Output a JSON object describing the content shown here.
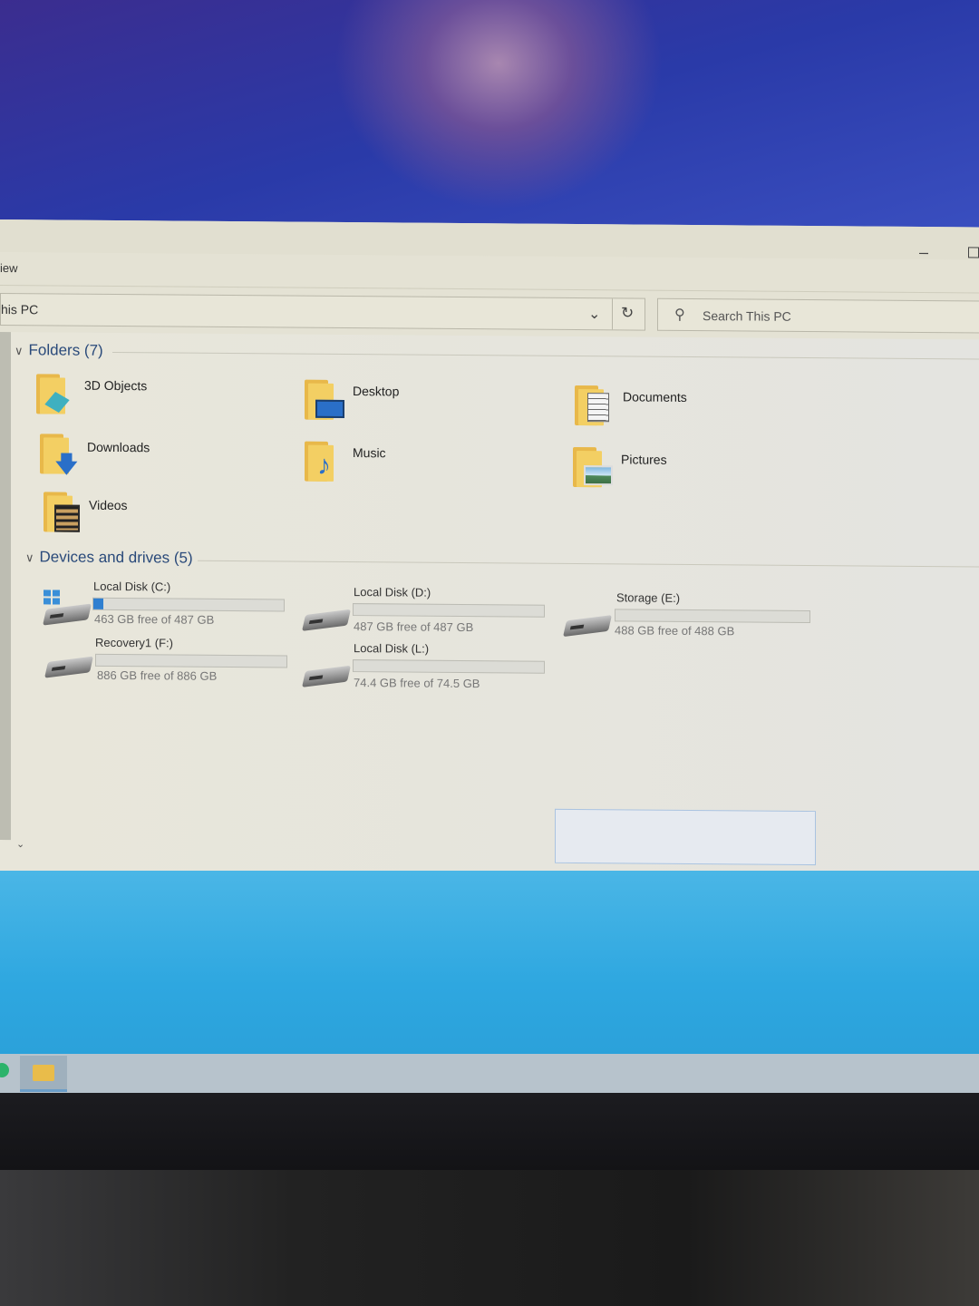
{
  "window": {
    "ribbon_tab": "iew",
    "address": "his PC",
    "search_placeholder": "Search This PC",
    "minimize_glyph": "–"
  },
  "folders": {
    "heading": "Folders (7)",
    "items": [
      {
        "label": "3D Objects",
        "icon": "3d-objects-folder-icon"
      },
      {
        "label": "Desktop",
        "icon": "desktop-folder-icon"
      },
      {
        "label": "Documents",
        "icon": "documents-folder-icon"
      },
      {
        "label": "Downloads",
        "icon": "downloads-folder-icon"
      },
      {
        "label": "Music",
        "icon": "music-folder-icon"
      },
      {
        "label": "Pictures",
        "icon": "pictures-folder-icon"
      },
      {
        "label": "Videos",
        "icon": "videos-folder-icon"
      }
    ]
  },
  "drives": {
    "heading": "Devices and drives (5)",
    "items": [
      {
        "name": "Local Disk (C:)",
        "free": "463 GB free of 487 GB",
        "used_fraction": 0.05
      },
      {
        "name": "Local Disk (D:)",
        "free": "487 GB free of 487 GB",
        "used_fraction": 0.0
      },
      {
        "name": "Storage (E:)",
        "free": "488 GB free of 488 GB",
        "used_fraction": 0.0
      },
      {
        "name": "Recovery1 (F:)",
        "free": "886 GB free of 886 GB",
        "used_fraction": 0.0
      },
      {
        "name": "Local Disk (L:)",
        "free": "74.4 GB free of 74.5 GB",
        "used_fraction": 0.0
      }
    ]
  },
  "colors": {
    "usage_bar": "#2f7fd0",
    "group_heading": "#2a4a7a"
  }
}
